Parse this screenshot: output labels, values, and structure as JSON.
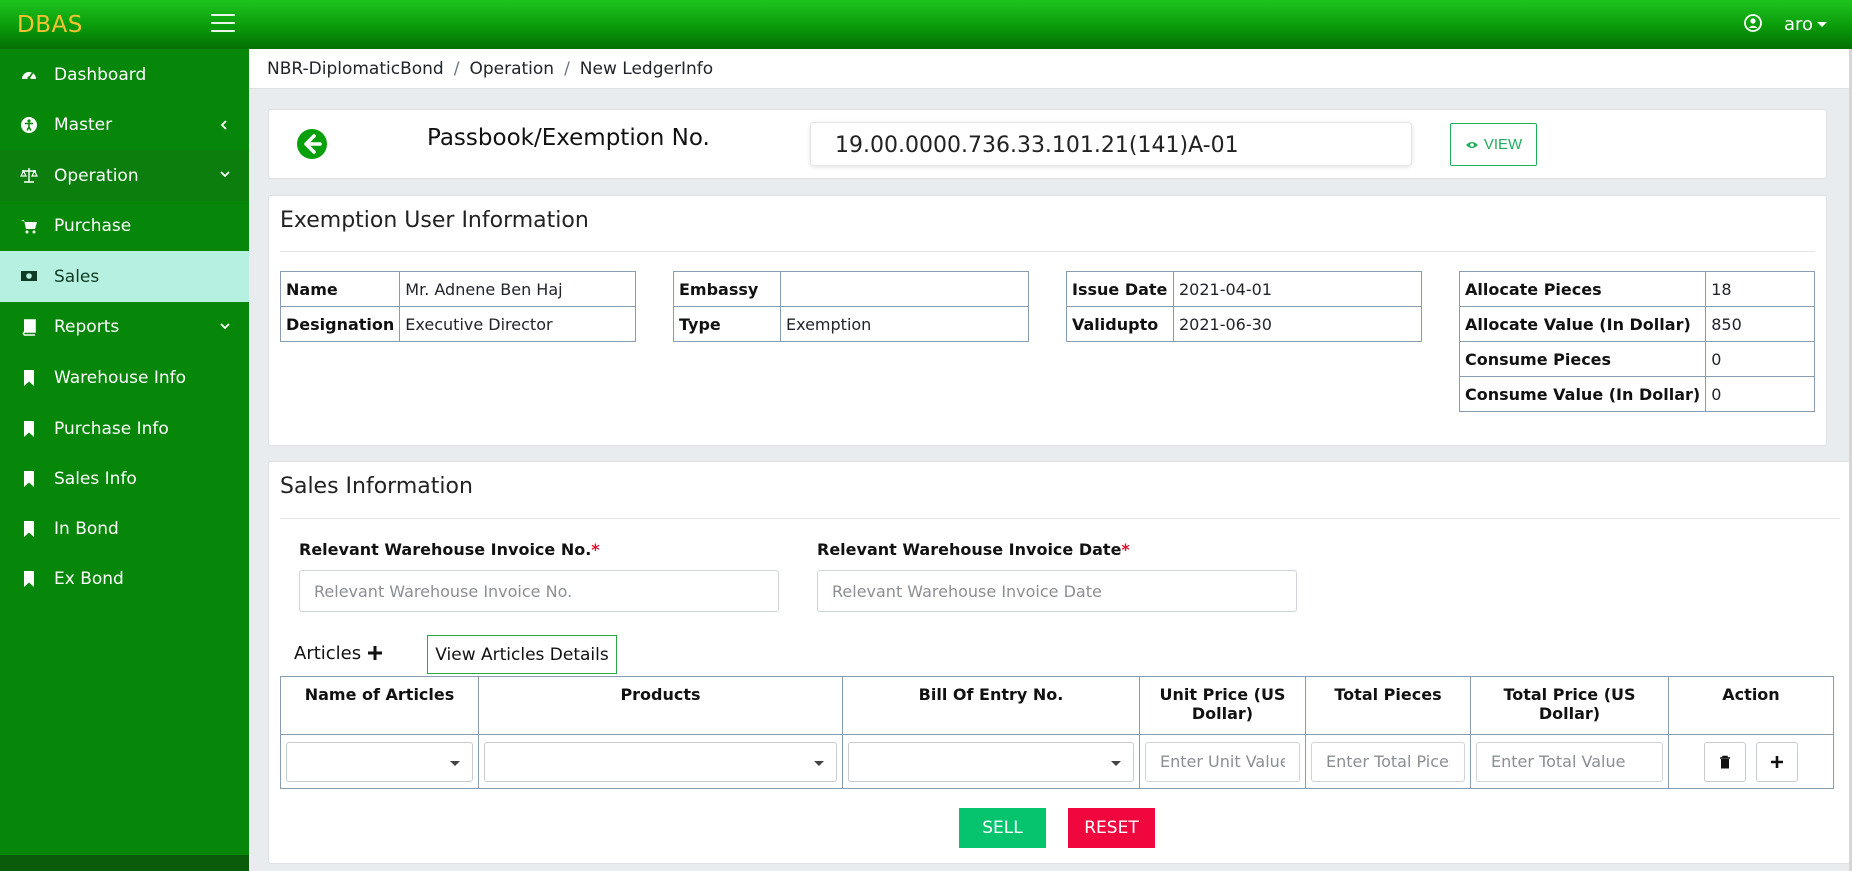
{
  "app": {
    "brand": "DBAS",
    "user": "aro"
  },
  "sidebar": {
    "items": [
      {
        "label": "Dashboard",
        "icon": "dashboard-icon"
      },
      {
        "label": "Master",
        "icon": "accessibility-icon"
      },
      {
        "label": "Operation",
        "icon": "balance-scale-icon"
      },
      {
        "label": "Purchase",
        "icon": "cart-icon"
      },
      {
        "label": "Sales",
        "icon": "money-icon"
      },
      {
        "label": "Reports",
        "icon": "book-icon"
      },
      {
        "label": "Warehouse Info",
        "icon": "bookmark-icon"
      },
      {
        "label": "Purchase Info",
        "icon": "bookmark-icon"
      },
      {
        "label": "Sales Info",
        "icon": "bookmark-icon"
      },
      {
        "label": "In Bond",
        "icon": "bookmark-icon"
      },
      {
        "label": "Ex Bond",
        "icon": "bookmark-icon"
      }
    ],
    "active": "Sales"
  },
  "breadcrumb": [
    "NBR-DiplomaticBond",
    "Operation",
    "New LedgerInfo"
  ],
  "passbook": {
    "label": "Passbook/Exemption No.",
    "value": "19.00.0000.736.33.101.21(141)A-01",
    "view_label": "VIEW"
  },
  "exemption": {
    "title": "Exemption User Information",
    "name_key": "Name",
    "name": "Mr. Adnene Ben Haj",
    "designation_key": "Designation",
    "designation": "Executive Director",
    "embassy_key": "Embassy",
    "embassy": "",
    "type_key": "Type",
    "type": "Exemption",
    "issue_key": "Issue Date",
    "issue": "2021-04-01",
    "valid_key": "Validupto",
    "valid": "2021-06-30",
    "alloc_pieces_key": "Allocate Pieces",
    "alloc_pieces": "18",
    "alloc_value_key": "Allocate Value (In Dollar)",
    "alloc_value": "850",
    "consume_pieces_key": "Consume Pieces",
    "consume_pieces": "0",
    "consume_value_key": "Consume Value (In Dollar)",
    "consume_value": "0"
  },
  "sales": {
    "title": "Sales Information",
    "invoice_no_label": "Relevant Warehouse Invoice No.",
    "invoice_no_placeholder": "Relevant Warehouse Invoice No.",
    "invoice_date_label": "Relevant Warehouse Invoice Date",
    "invoice_date_placeholder": "Relevant Warehouse Invoice Date",
    "required_mark": "*",
    "articles_label": "Articles",
    "view_details_label": "View Articles Details",
    "columns": [
      "Name of Articles",
      "Products",
      "Bill Of Entry No.",
      "Unit Price (US Dollar)",
      "Total Pieces",
      "Total Price (US Dollar)",
      "Action"
    ],
    "unit_placeholder": "Enter Unit Value",
    "pieces_placeholder": "Enter Total Pices",
    "total_placeholder": "Enter Total Value",
    "sell_label": "SELL",
    "reset_label": "RESET"
  },
  "colors": {
    "brand_green": "#07870a",
    "accent": "#f2c230",
    "active_item": "#b5f0e0",
    "sell": "#06c46e",
    "reset": "#f0073e"
  }
}
